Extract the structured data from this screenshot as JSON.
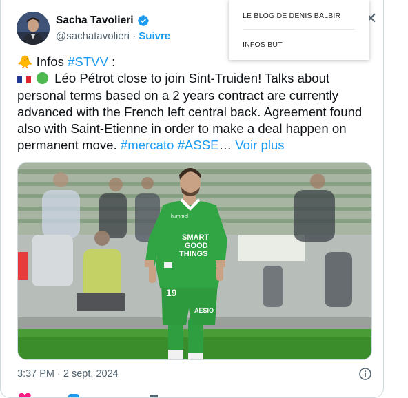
{
  "tweet": {
    "author_name": "Sacha Tavolieri",
    "author_handle": "@sachatavolieri",
    "separator": "·",
    "follow_label": "Suivre",
    "line1_prefix": "Infos",
    "line1_hashtag": "#STVV",
    "line1_suffix": ":",
    "body": "Léo Pétrot close to join Sint-Truiden! Talks about personal terms based on a 2 years contract are currently advanced with the French left central back. Agreement found also with Saint-Etienne in order to make a deal happen on permanent move.",
    "hashtag1": "#mercato",
    "hashtag2": "#ASSE",
    "ellipsis": "…",
    "see_more": "Voir plus",
    "timestamp": "3:37 PM · 2 sept. 2024",
    "image": {
      "shirt_sponsor_1": "SMART",
      "shirt_sponsor_2": "GOOD",
      "shirt_sponsor_3": "THINGS",
      "shirt_number": "19",
      "shirt_brand": "hummel",
      "short_sponsor": "AESIO"
    }
  },
  "menu": {
    "items": [
      {
        "label": "LE BLOG DE DENIS BALBIR"
      },
      {
        "label": "INFOS BUT"
      }
    ]
  },
  "icons": [
    "verified-badge-icon",
    "close-icon",
    "info-icon",
    "heart-icon",
    "reply-icon",
    "share-icon"
  ],
  "colors": {
    "accent": "#1d9bf0",
    "text": "#0f1419",
    "muted": "#536471",
    "jersey": "#2f9e41"
  }
}
